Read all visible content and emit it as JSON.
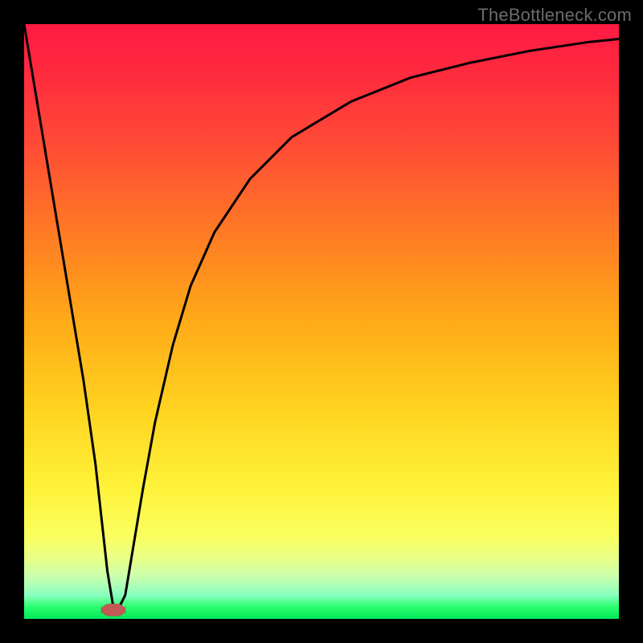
{
  "watermark": "TheBottleneck.com",
  "colors": {
    "frame": "#000000",
    "curve_stroke": "#000000",
    "marker_fill": "#c45a55",
    "marker_stroke": "#b6544f",
    "gradient_top": "#ff1a44",
    "gradient_bottom": "#00e85a"
  },
  "chart_data": {
    "type": "line",
    "title": "",
    "xlabel": "",
    "ylabel": "",
    "xlim": [
      0,
      100
    ],
    "ylim": [
      0,
      100
    ],
    "grid": false,
    "series": [
      {
        "name": "mismatch-curve",
        "x_percent": [
          0,
          2,
          4,
          6,
          8,
          10,
          12,
          13,
          14,
          15,
          16,
          17,
          18,
          20,
          22,
          25,
          28,
          32,
          38,
          45,
          55,
          65,
          75,
          85,
          95,
          100
        ],
        "y_percent": [
          100,
          88,
          76,
          64,
          52,
          40,
          26,
          17,
          8,
          2,
          2,
          4,
          10,
          22,
          33,
          46,
          56,
          65,
          74,
          81,
          87,
          91,
          93.5,
          95.5,
          97,
          97.5
        ]
      }
    ],
    "marker": {
      "name": "optimal-point",
      "x_percent": 15,
      "y_percent": 1.5,
      "width_percent": 4,
      "height_percent": 2
    }
  }
}
